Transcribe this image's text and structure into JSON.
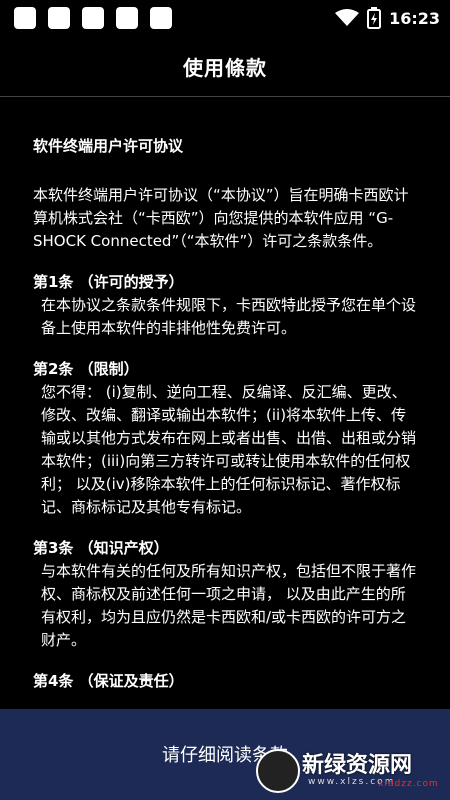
{
  "status_bar": {
    "time": "16:23",
    "icons": [
      "notification-square-icon",
      "notification-square-icon",
      "notification-square-icon",
      "notification-square-icon",
      "notification-square-icon",
      "wifi-icon",
      "battery-charging-icon"
    ]
  },
  "header": {
    "title": "使用條款"
  },
  "document": {
    "title": "软件终端用户许可协议",
    "intro": "本软件终端用户许可协议（“本协议”）旨在明确卡西欧计算机株式会社（“卡西欧”）向您提供的本软件应用 “G-SHOCK Connected”（“本软件”）许可之条款条件。",
    "articles": [
      {
        "title": "第1条 （许可的授予）",
        "body": "在本协议之条款条件规限下，卡西欧特此授予您在单个设备上使用本软件的非排他性免费许可。"
      },
      {
        "title": "第2条 （限制）",
        "body": "您不得： (i)复制、逆向工程、反编译、反汇编、更改、修改、改编、翻译或输出本软件；(ii)将本软件上传、传输或以其他方式发布在网上或者出售、出借、出租或分销本软件；(iii)向第三方转许可或转让使用本软件的任何权利； 以及(iv)移除本软件上的任何标识标记、著作权标记、商标标记及其他专有标记。"
      },
      {
        "title": "第3条 （知识产权）",
        "body": "与本软件有关的任何及所有知识产权，包括但不限于著作权、商标权及前述任何一项之申请， 以及由此产生的所有权利，均为且应仍然是卡西欧和/或卡西欧的许可方之财产。"
      },
      {
        "title": "第4条 （保证及责任）",
        "body": ""
      }
    ]
  },
  "footer": {
    "label": "请仔细阅读条款",
    "watermark": {
      "text": "新绿资源网",
      "url": "www.xlzs.com",
      "url2": "xlddzz.com"
    }
  },
  "colors": {
    "background": "#000000",
    "footer": "#1d2a55",
    "text": "#ffffff"
  }
}
